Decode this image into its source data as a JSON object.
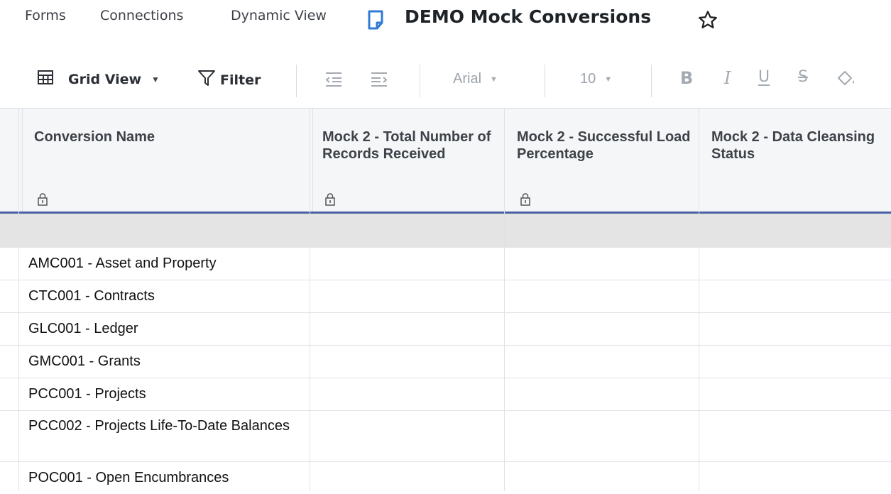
{
  "nav": {
    "forms": "Forms",
    "connections": "Connections",
    "dynamic_view": "Dynamic View",
    "title": "DEMO Mock Conversions"
  },
  "toolbar": {
    "view": "Grid View",
    "filter": "Filter",
    "font": "Arial",
    "font_size": "10",
    "bold": "B",
    "italic": "I",
    "underline": "U",
    "strike": "S"
  },
  "columns": [
    {
      "label": "Conversion Name",
      "locked": true
    },
    {
      "label": "Mock 2 - Total Number of Records Received",
      "locked": true
    },
    {
      "label": "Mock 2 - Successful Load Percentage",
      "locked": true
    },
    {
      "label": "Mock 2 - Data Cleansing Status",
      "locked": false
    }
  ],
  "rows": [
    "AMC001 - Asset and Property",
    "CTC001 - Contracts",
    "GLC001 - Ledger",
    "GMC001 - Grants",
    "PCC001 - Projects",
    "PCC002 - Projects Life-To-Date Balances",
    "POC001 - Open Encumbrances"
  ],
  "colors": {
    "accent_line": "#4a62a5",
    "sheet_icon": "#2f7bd5",
    "header_bg": "#f5f6f7",
    "blank_row": "#e4e4e4"
  }
}
